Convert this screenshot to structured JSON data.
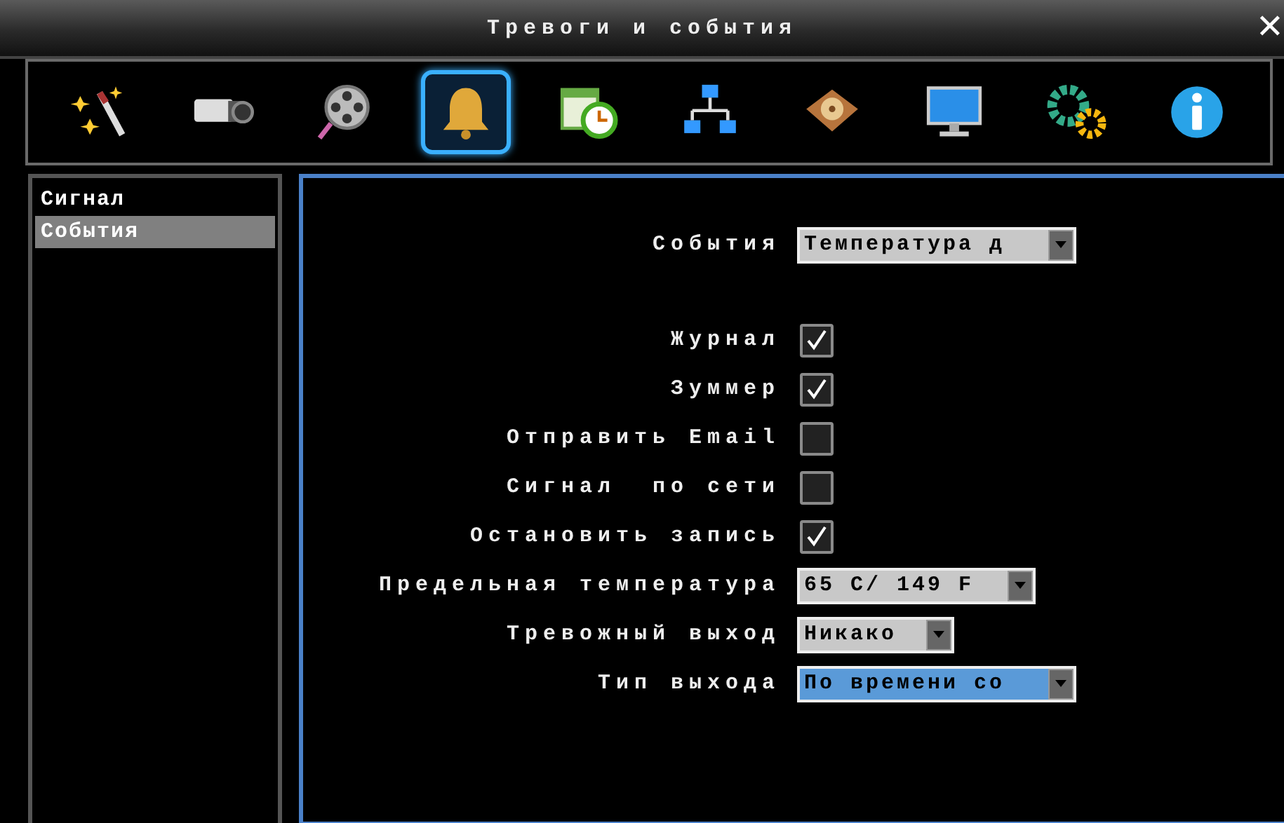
{
  "window": {
    "title": "Тревоги и события",
    "close": "✕"
  },
  "toolbar": [
    {
      "kind": "wand",
      "selected": false
    },
    {
      "kind": "camera",
      "selected": false
    },
    {
      "kind": "film",
      "selected": false
    },
    {
      "kind": "bell",
      "selected": true
    },
    {
      "kind": "schedule",
      "selected": false
    },
    {
      "kind": "network",
      "selected": false
    },
    {
      "kind": "disk",
      "selected": false
    },
    {
      "kind": "monitor",
      "selected": false
    },
    {
      "kind": "gears",
      "selected": false
    },
    {
      "kind": "info",
      "selected": false
    }
  ],
  "sidebar": {
    "items": [
      {
        "label": "Сигнал",
        "selected": false
      },
      {
        "label": "События",
        "selected": true
      }
    ]
  },
  "form": [
    {
      "kind": "select",
      "label": "События",
      "value": "Температура д",
      "focused": false
    },
    {
      "kind": "gap"
    },
    {
      "kind": "checkbox",
      "label": "Журнал",
      "checked": true
    },
    {
      "kind": "checkbox",
      "label": "Зуммер",
      "checked": true
    },
    {
      "kind": "checkbox",
      "label": "Отправить Email",
      "checked": false
    },
    {
      "kind": "checkbox",
      "label": "Сигнал  по сети",
      "checked": false
    },
    {
      "kind": "checkbox",
      "label": "Остановить запись",
      "checked": true
    },
    {
      "kind": "select",
      "label": "Предельная температура",
      "value": "65 C/ 149 F",
      "focused": false
    },
    {
      "kind": "select",
      "label": "Тревожный выход",
      "value": "Никако",
      "focused": false
    },
    {
      "kind": "select",
      "label": "Тип выхода",
      "value": "По времени со",
      "focused": true
    }
  ]
}
